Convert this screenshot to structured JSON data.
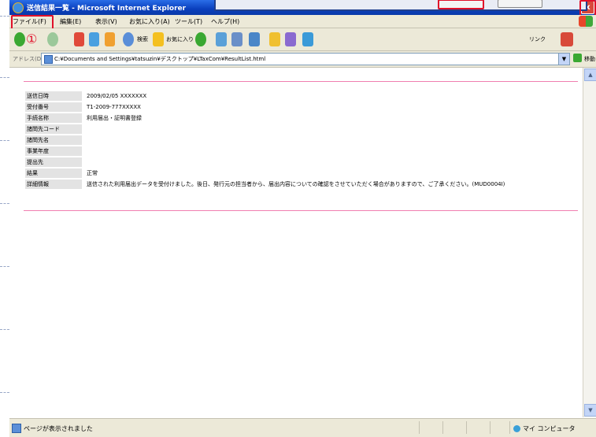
{
  "window": {
    "title": "送信結果一覧 - Microsoft Internet Explorer",
    "close_label": "x"
  },
  "menu": {
    "items": [
      "ファイル(F)",
      "編集(E)",
      "表示(V)",
      "お気に入り(A)",
      "ツール(T)",
      "ヘルプ(H)"
    ]
  },
  "toolbar": {
    "step_marker": "①",
    "search_label": "検索",
    "favorites_label": "お気に入り",
    "links_label": "リンク"
  },
  "address": {
    "label": "アドレス(D)",
    "url": "C:¥Documents and Settings¥tatsuzin¥デスクトップ¥LTaxCom¥ResultList.html",
    "go_label": "移動"
  },
  "result": {
    "rows": [
      {
        "label": "送信日時",
        "value": "2009/02/05 XXXXXXX"
      },
      {
        "label": "受付番号",
        "value": "T1-2009-777XXXXX"
      },
      {
        "label": "手続名称",
        "value": "利用届出・証明書登録"
      },
      {
        "label": "諸問先コード",
        "value": ""
      },
      {
        "label": "諸問先名",
        "value": ""
      },
      {
        "label": "事業年度",
        "value": ""
      },
      {
        "label": "提出先",
        "value": ""
      },
      {
        "label": "結果",
        "value": "正常"
      },
      {
        "label": "詳細情報",
        "value": "送信された利用届出データを受付けました。後日、発行元の担当者から、届出内容についての確認をさせていただく場合がありますので、ご了承ください。(MUD0004I)"
      }
    ]
  },
  "status": {
    "text": "ページが表示されました",
    "zone": "マイ コンピュータ"
  },
  "colors": {
    "title_bar": "#0a3fbd",
    "chrome": "#ece9d8",
    "highlight": "#e0102a",
    "divider": "#f07fb0"
  }
}
